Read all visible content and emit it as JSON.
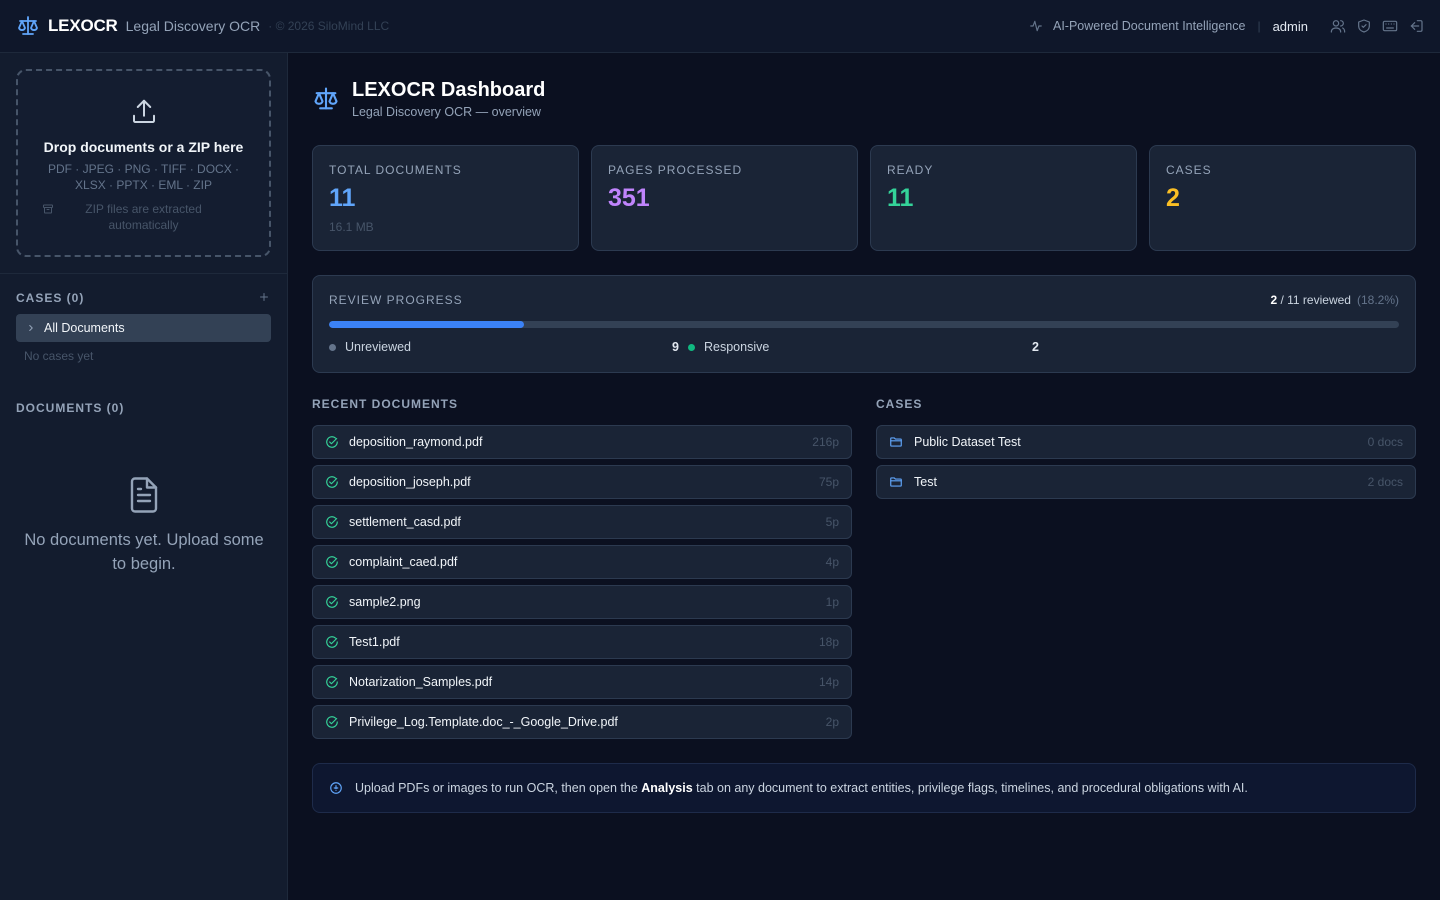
{
  "header": {
    "brand": "LEXOCR",
    "subtitle": "Legal Discovery OCR",
    "copyright": "· © 2026 SiloMind LLC",
    "tagline": "AI-Powered Document Intelligence",
    "separator": "|",
    "user": "admin",
    "icons": [
      "activity-icon",
      "users-icon",
      "shield-icon",
      "keyboard-icon",
      "logout-icon"
    ]
  },
  "sidebar": {
    "dropzone": {
      "title": "Drop documents or a ZIP here",
      "formats_line1": "PDF · JPEG · PNG · TIFF · DOCX ·",
      "formats_line2": "XLSX · PPTX · EML · ZIP",
      "zip_note": "ZIP files are extracted automatically"
    },
    "cases_title": "CASES (0)",
    "all_documents": "All Documents",
    "no_cases": "No cases yet",
    "documents_title": "DOCUMENTS (0)",
    "empty_docs": "No documents yet. Upload some to begin."
  },
  "dashboard": {
    "title": "LEXOCR Dashboard",
    "subtitle": "Legal Discovery OCR — overview"
  },
  "stats": [
    {
      "label": "TOTAL DOCUMENTS",
      "value": "11",
      "sub": "16.1 MB",
      "color": "#60a5fa"
    },
    {
      "label": "PAGES PROCESSED",
      "value": "351",
      "sub": "",
      "color": "#c084fc"
    },
    {
      "label": "READY",
      "value": "11",
      "sub": "",
      "color": "#34d399"
    },
    {
      "label": "CASES",
      "value": "2",
      "sub": "",
      "color": "#fbbf24"
    }
  ],
  "review": {
    "label": "REVIEW PROGRESS",
    "reviewed": "2",
    "total_text": " / 11 reviewed",
    "percent_text": "(18.2%)",
    "fraction": 0.182,
    "legend": [
      {
        "label": "Unreviewed",
        "count": "9",
        "color": "#64748b"
      },
      {
        "label": "Responsive",
        "count": "2",
        "color": "#10b981"
      }
    ]
  },
  "recent_documents": {
    "title": "RECENT DOCUMENTS",
    "items": [
      {
        "name": "deposition_raymond.pdf",
        "pages": "216p"
      },
      {
        "name": "deposition_joseph.pdf",
        "pages": "75p"
      },
      {
        "name": "settlement_casd.pdf",
        "pages": "5p"
      },
      {
        "name": "complaint_caed.pdf",
        "pages": "4p"
      },
      {
        "name": "sample2.png",
        "pages": "1p"
      },
      {
        "name": "Test1.pdf",
        "pages": "18p"
      },
      {
        "name": "Notarization_Samples.pdf",
        "pages": "14p"
      },
      {
        "name": "Privilege_Log.Template.doc_-_Google_Drive.pdf",
        "pages": "2p"
      }
    ]
  },
  "cases": {
    "title": "CASES",
    "items": [
      {
        "name": "Public Dataset Test",
        "docs": "0 docs"
      },
      {
        "name": "Test",
        "docs": "2 docs"
      }
    ]
  },
  "info": {
    "before": "Upload PDFs or images to run OCR, then open the ",
    "bold": "Analysis",
    "after": " tab on any document to extract entities, privilege flags, timelines, and procedural obligations with AI."
  }
}
